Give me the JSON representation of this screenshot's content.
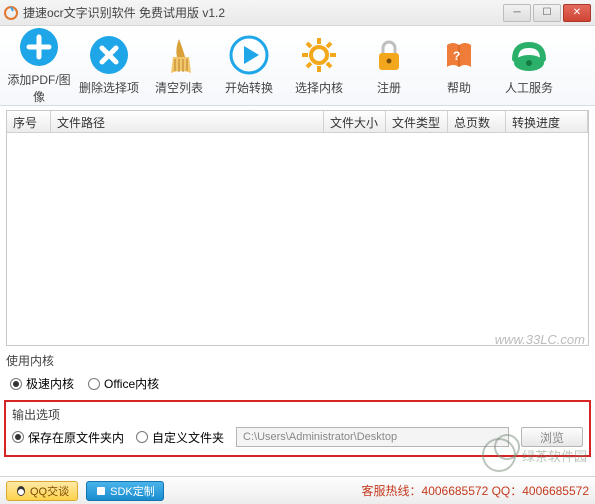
{
  "window": {
    "title": "捷速ocr文字识别软件 免费试用版 v1.2"
  },
  "toolbar": {
    "add": "添加PDF/图像",
    "remove": "删除选择项",
    "clear": "清空列表",
    "start": "开始转换",
    "kernel": "选择内核",
    "register": "注册",
    "help": "帮助",
    "service": "人工服务"
  },
  "table": {
    "seq": "序号",
    "path": "文件路径",
    "size": "文件大小",
    "type": "文件类型",
    "pages": "总页数",
    "progress": "转换进度"
  },
  "kernel_section": {
    "label": "使用内核",
    "fast": "极速内核",
    "office": "Office内核"
  },
  "output_section": {
    "label": "输出选项",
    "save_original": "保存在原文件夹内",
    "save_custom": "自定义文件夹",
    "path": "C:\\Users\\Administrator\\Desktop",
    "browse": "浏览"
  },
  "footer": {
    "qq": "QQ交谈",
    "sdk": "SDK定制",
    "hotline": "客服热线：4006685572 QQ：4006685572"
  },
  "watermark": {
    "text": "绿茶软件园",
    "url": "www.33LC.com"
  }
}
